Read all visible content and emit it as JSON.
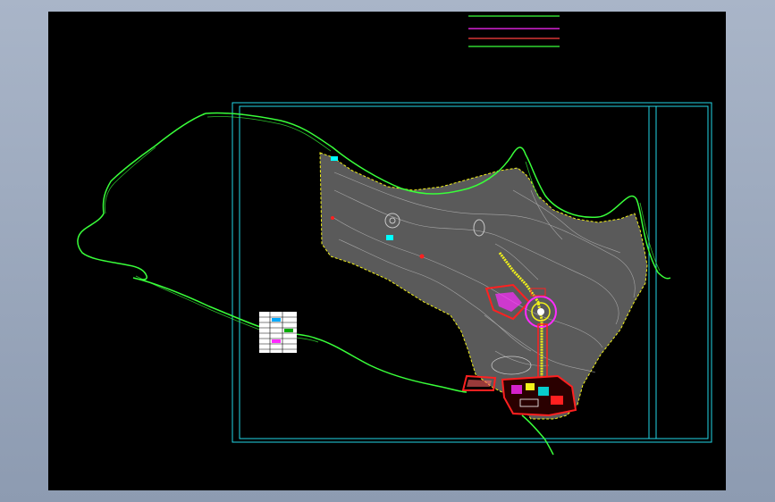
{
  "app": {
    "title": ""
  },
  "colors": {
    "background_desktop": "#9aa6bb",
    "canvas": "#000000",
    "frame": "#22d6e6",
    "road": "#39ff3a",
    "site_fill": "#5a5a5a",
    "boundary": "#f2f21a",
    "building": "#ff2020",
    "accent_magenta": "#ff2bff",
    "accent_cyan": "#00ffff",
    "contour": "#b4b4b4"
  },
  "legend": {
    "lines": [
      {
        "color": "#39ff3a",
        "label": ""
      },
      {
        "color": "#ff2bff",
        "label": ""
      },
      {
        "color": "#ff4040",
        "label": ""
      },
      {
        "color": "#39ff3a",
        "label": ""
      }
    ]
  },
  "drawing": {
    "type": "cad-site-plan",
    "has_title_block": true,
    "has_table": true
  }
}
